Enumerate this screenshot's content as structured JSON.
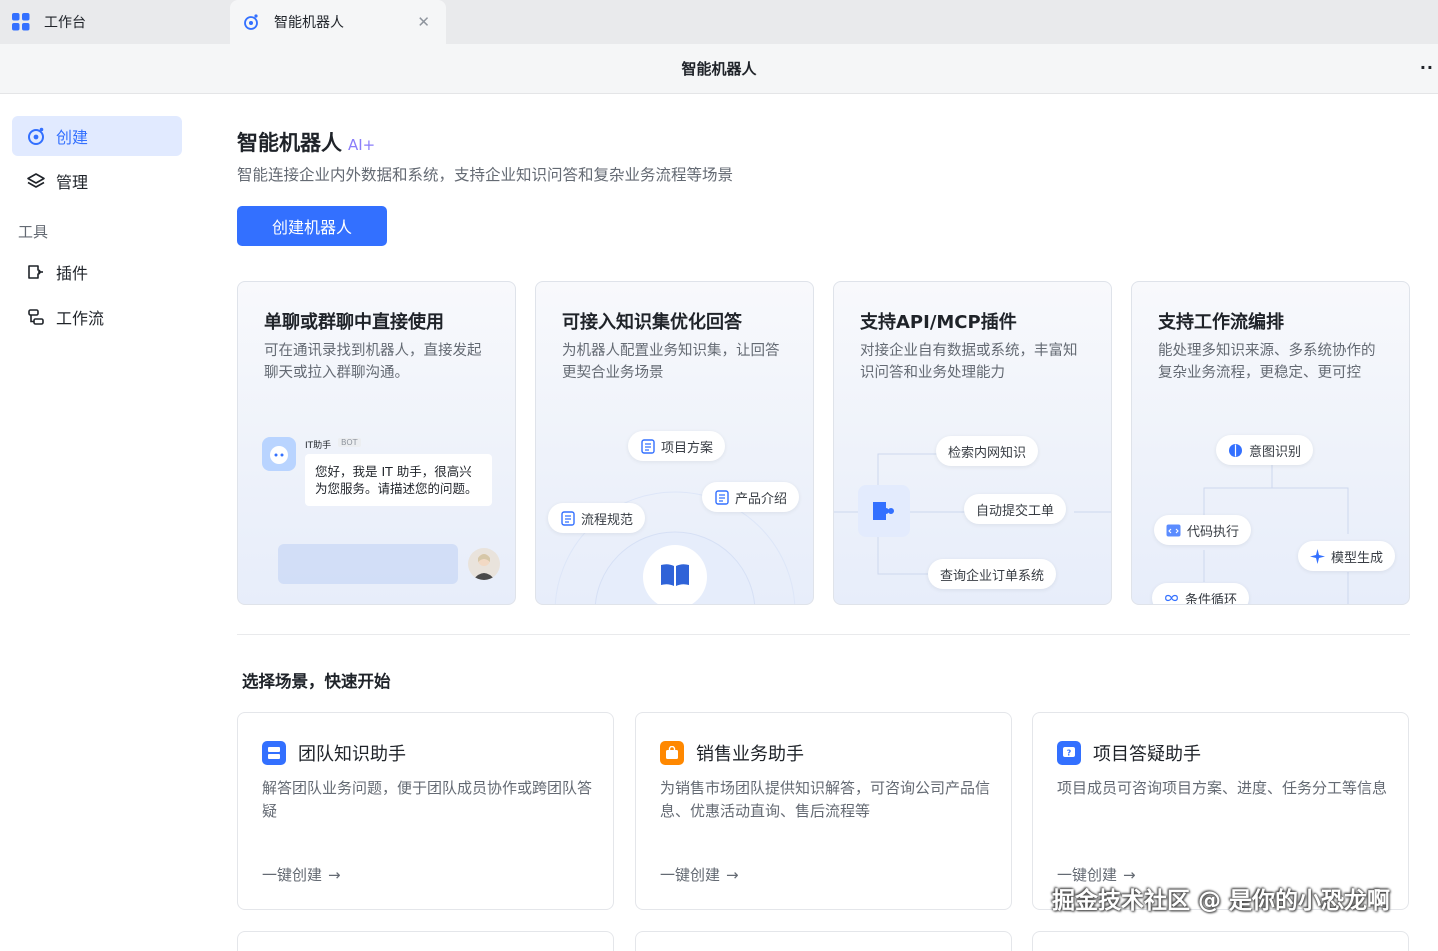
{
  "tabs": [
    {
      "label": "工作台",
      "icon": "apps-grid-icon"
    },
    {
      "label": "智能机器人",
      "icon": "robot-icon",
      "closable": true
    }
  ],
  "header": {
    "title": "智能机器人",
    "more": "⋮"
  },
  "sidebar": {
    "items": [
      {
        "label": "创建",
        "icon": "robot-icon",
        "active": true
      },
      {
        "label": "管理",
        "icon": "layers-icon"
      }
    ],
    "section_label": "工具",
    "tools": [
      {
        "label": "插件",
        "icon": "plugin-icon"
      },
      {
        "label": "工作流",
        "icon": "workflow-icon"
      }
    ]
  },
  "main": {
    "title": "智能机器人",
    "ai_badge": "AI+",
    "subtitle": "智能连接企业内外数据和系统，支持企业知识问答和复杂业务流程等场景",
    "create_button": "创建机器人",
    "features": [
      {
        "title": "单聊或群聊中直接使用",
        "desc": "可在通讯录找到机器人，直接发起聊天或拉入群聊沟通。",
        "chat": {
          "bot_name": "IT助手",
          "bot_tag": "BOT",
          "message": "您好，我是 IT 助手，很高兴为您服务。请描述您的问题。"
        }
      },
      {
        "title": "可接入知识集优化回答",
        "desc": "为机器人配置业务知识集，让回答更契合业务场景",
        "tags": [
          "项目方案",
          "产品介绍",
          "流程规范"
        ]
      },
      {
        "title": "支持API/MCP插件",
        "desc": "对接企业自有数据或系统，丰富知识问答和业务处理能力",
        "tags": [
          "检索内网知识",
          "自动提交工单",
          "查询企业订单系统"
        ]
      },
      {
        "title": "支持工作流编排",
        "desc": "能处理多知识来源、多系统协作的复杂业务流程，更稳定、更可控",
        "tags": [
          "意图识别",
          "代码执行",
          "模型生成",
          "条件循环"
        ]
      }
    ],
    "scenes_title": "选择场景，快速开始",
    "scenes": [
      {
        "title": "团队知识助手",
        "desc": "解答团队业务问题，便于团队成员协作或跨团队答疑",
        "link": "一键创建",
        "color": "#3370ff",
        "icon": "database-icon"
      },
      {
        "title": "销售业务助手",
        "desc": "为销售市场团队提供知识解答，可咨询公司产品信息、优惠活动直询、售后流程等",
        "link": "一键创建",
        "color": "#ff8800",
        "icon": "shopping-bag-icon"
      },
      {
        "title": "项目答疑助手",
        "desc": "项目成员可咨询项目方案、进度、任务分工等信息",
        "link": "一键创建",
        "color": "#3370ff",
        "icon": "question-icon"
      }
    ]
  },
  "watermark": "掘金技术社区 @ 是你的小恐龙啊"
}
